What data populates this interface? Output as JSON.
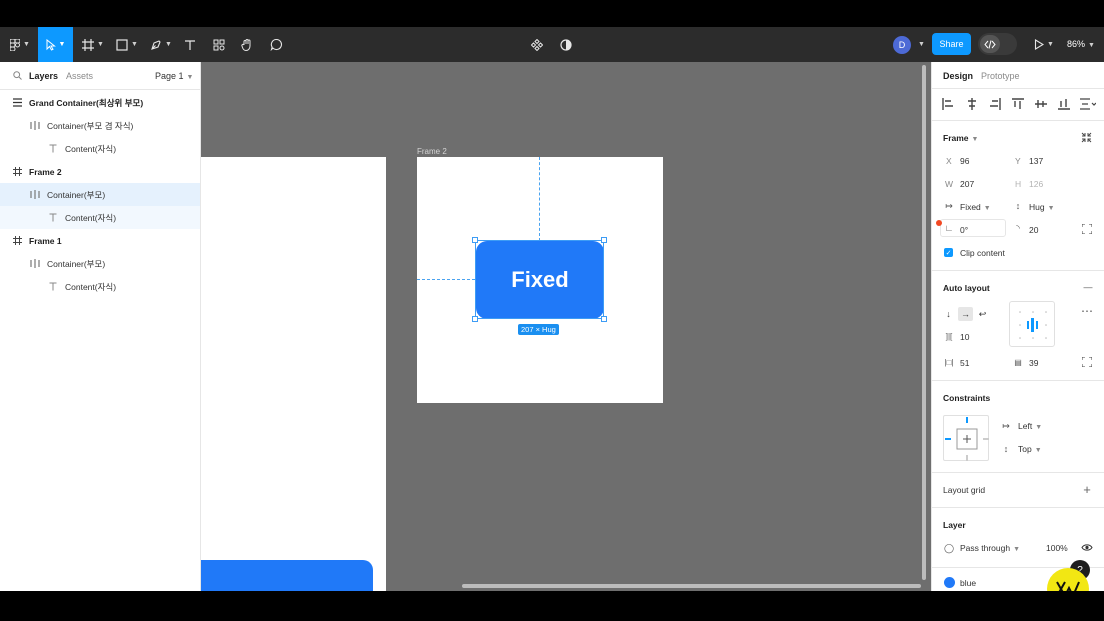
{
  "toolbar": {
    "share_label": "Share",
    "avatar_initial": "D",
    "zoom": "86%"
  },
  "left_panel": {
    "tabs": {
      "layers": "Layers",
      "assets": "Assets"
    },
    "page": "Page 1",
    "layers": [
      {
        "name": "Grand Container(최상위 부모)",
        "icon": "auto-layout-vertical-icon",
        "depth": 0
      },
      {
        "name": "Container(부모 겸 자식)",
        "icon": "auto-layout-horizontal-icon",
        "depth": 1
      },
      {
        "name": "Content(자식)",
        "icon": "text-icon",
        "depth": 2
      },
      {
        "name": "Frame 2",
        "icon": "frame-icon",
        "depth": 0
      },
      {
        "name": "Container(부모)",
        "icon": "auto-layout-horizontal-icon",
        "depth": 1,
        "selected": true
      },
      {
        "name": "Content(자식)",
        "icon": "text-icon",
        "depth": 2
      },
      {
        "name": "Frame 1",
        "icon": "frame-icon",
        "depth": 0
      },
      {
        "name": "Container(부모)",
        "icon": "auto-layout-horizontal-icon",
        "depth": 1
      },
      {
        "name": "Content(자식)",
        "icon": "text-icon",
        "depth": 2
      }
    ]
  },
  "canvas": {
    "frame2_label": "Frame 2",
    "button_text": "Fixed",
    "size_badge": "207 × Hug"
  },
  "right_panel": {
    "tabs": {
      "design": "Design",
      "prototype": "Prototype"
    },
    "frame": {
      "title": "Frame",
      "x_label": "X",
      "x": "96",
      "y_label": "Y",
      "y": "137",
      "w_label": "W",
      "w": "207",
      "h_label": "H",
      "h": "126",
      "width_mode": "Fixed",
      "height_mode": "Hug",
      "rotation": "0°",
      "radius": "20",
      "clip_content": "Clip content"
    },
    "auto_layout": {
      "title": "Auto layout",
      "gap": "10",
      "padding_h": "51",
      "padding_v": "39"
    },
    "constraints": {
      "title": "Constraints",
      "horizontal": "Left",
      "vertical": "Top"
    },
    "layout_grid": {
      "title": "Layout grid"
    },
    "layer": {
      "title": "Layer",
      "blend": "Pass through",
      "opacity": "100%"
    },
    "fill": {
      "name": "blue",
      "color": "#2079f8"
    }
  },
  "colors": {
    "accent": "#0d99ff",
    "button_blue": "#2079f8",
    "canvas_bg": "#6e6e6e",
    "toolbar_bg": "#2c2c2c",
    "brand_badge": "#f2e713"
  }
}
